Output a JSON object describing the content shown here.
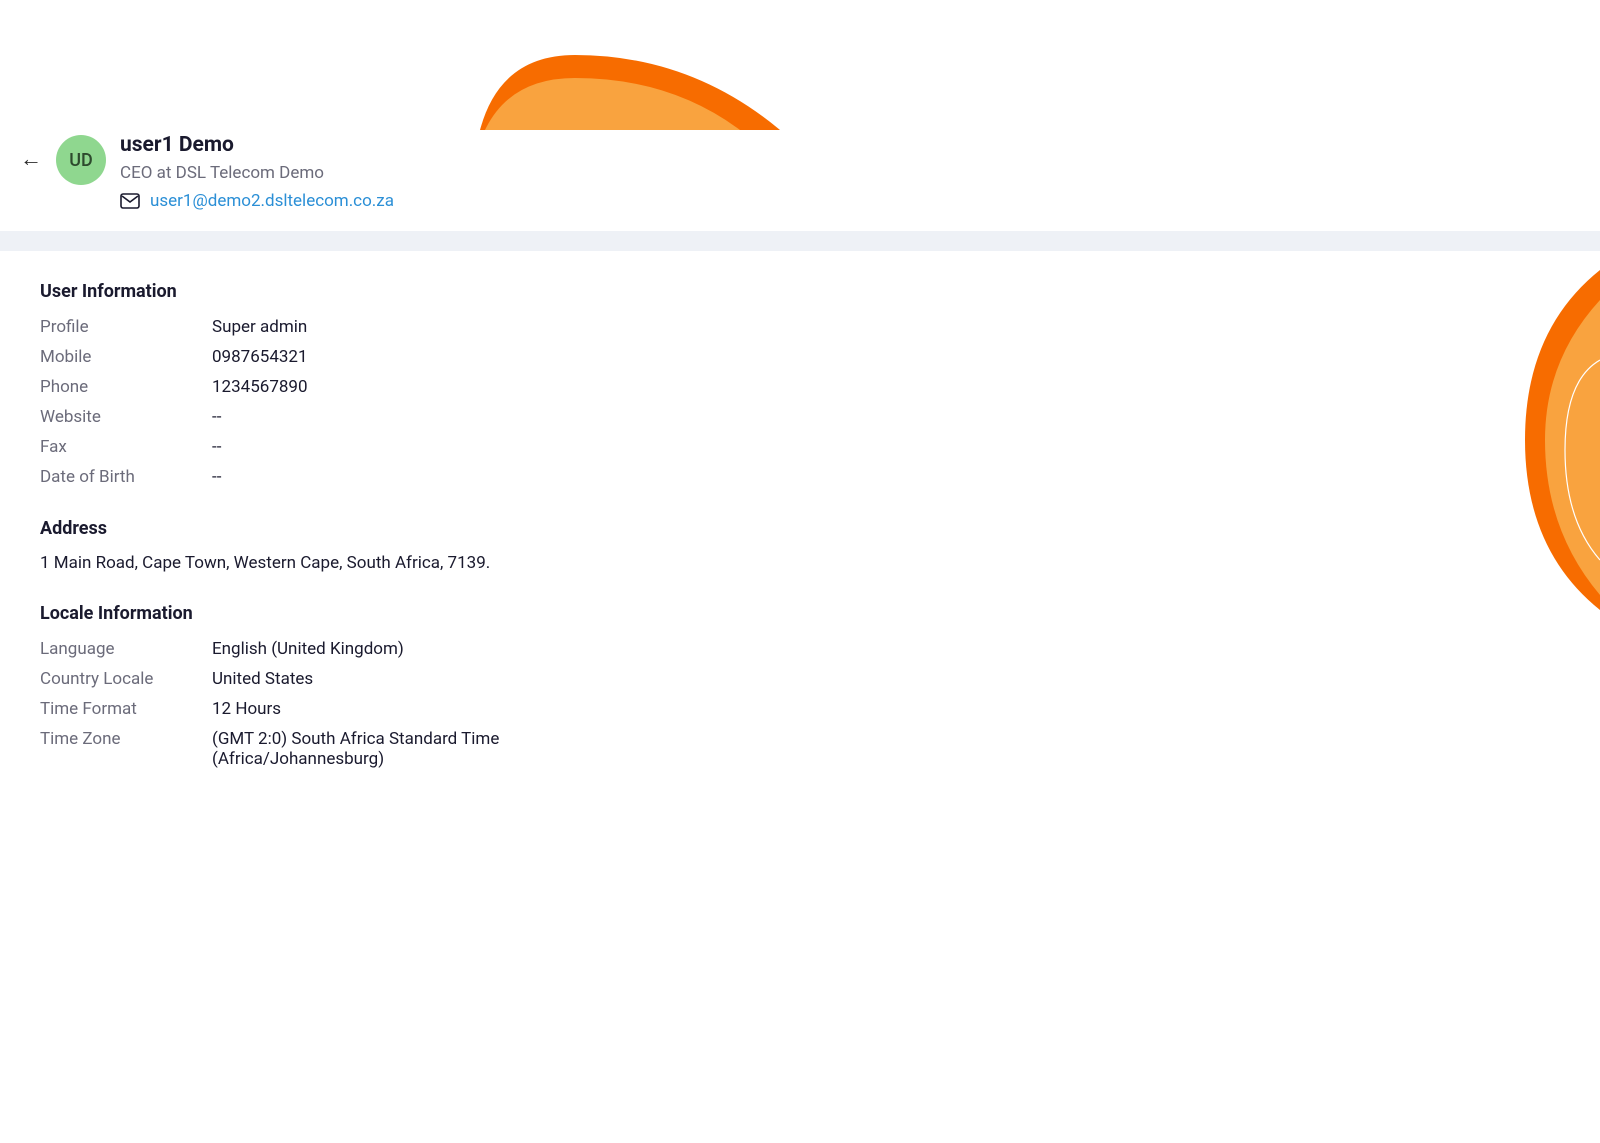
{
  "header": {
    "avatar_initials": "UD",
    "name": "user1 Demo",
    "title": "CEO at DSL Telecom Demo",
    "email": "user1@demo2.dsltelecom.co.za"
  },
  "sections": {
    "user_info": {
      "title": "User Information",
      "fields": {
        "profile": {
          "label": "Profile",
          "value": "Super admin"
        },
        "mobile": {
          "label": "Mobile",
          "value": "0987654321"
        },
        "phone": {
          "label": "Phone",
          "value": "1234567890"
        },
        "website": {
          "label": "Website",
          "value": "--"
        },
        "fax": {
          "label": "Fax",
          "value": "--"
        },
        "dob": {
          "label": "Date of Birth",
          "value": "--"
        }
      }
    },
    "address": {
      "title": "Address",
      "value": "1 Main Road, Cape Town, Western Cape, South Africa, 7139."
    },
    "locale": {
      "title": "Locale Information",
      "fields": {
        "language": {
          "label": "Language",
          "value": "English (United Kingdom)"
        },
        "country_locale": {
          "label": "Country Locale",
          "value": "United States"
        },
        "time_format": {
          "label": "Time Format",
          "value": "12 Hours"
        },
        "time_zone": {
          "label": "Time Zone",
          "value": "(GMT 2:0) South Africa Standard Time (Africa/Johannesburg)"
        }
      }
    }
  },
  "colors": {
    "accent_orange_dark": "#f76c00",
    "accent_orange_light": "#f9a33f",
    "avatar_bg": "#8fd78f",
    "link": "#2b8fd6"
  }
}
